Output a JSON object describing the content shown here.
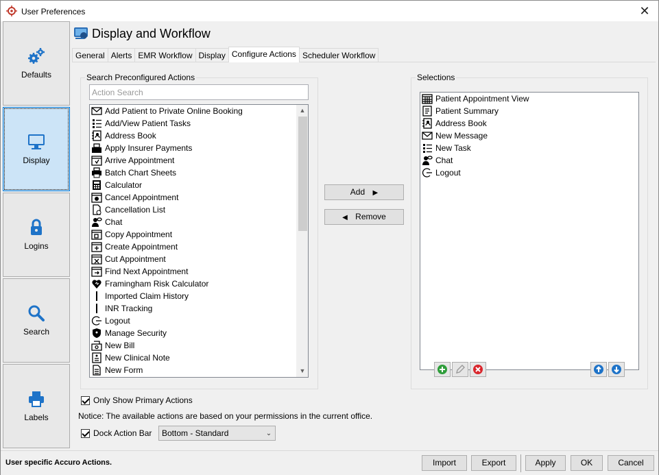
{
  "window": {
    "title": "User Preferences",
    "close_glyph": "✕"
  },
  "sidebar": {
    "items": [
      {
        "label": "Defaults",
        "icon": "gears-icon"
      },
      {
        "label": "Display",
        "icon": "monitor-icon"
      },
      {
        "label": "Logins",
        "icon": "lock-icon"
      },
      {
        "label": "Search",
        "icon": "magnifier-icon"
      },
      {
        "label": "Labels",
        "icon": "printer-icon"
      }
    ]
  },
  "header": {
    "title": "Display and Workflow"
  },
  "tabs": [
    "General",
    "Alerts",
    "EMR Workflow",
    "Display",
    "Configure Actions",
    "Scheduler Workflow"
  ],
  "search_group": {
    "title": "Search Preconfigured Actions",
    "search_placeholder": "Action Search",
    "actions": [
      {
        "label": "Add Patient to Private Online Booking",
        "icon": "envelope-arrow-icon"
      },
      {
        "label": "Add/View Patient Tasks",
        "icon": "task-list-icon"
      },
      {
        "label": "Address Book",
        "icon": "address-book-icon"
      },
      {
        "label": "Apply Insurer Payments",
        "icon": "cash-register-icon"
      },
      {
        "label": "Arrive Appointment",
        "icon": "calendar-arrive-icon"
      },
      {
        "label": "Batch Chart Sheets",
        "icon": "printer-icon"
      },
      {
        "label": "Calculator",
        "icon": "calculator-icon"
      },
      {
        "label": "Cancel Appointment",
        "icon": "calendar-cancel-icon"
      },
      {
        "label": "Cancellation List",
        "icon": "document-icon"
      },
      {
        "label": "Chat",
        "icon": "chat-icon"
      },
      {
        "label": "Copy Appointment",
        "icon": "calendar-copy-icon"
      },
      {
        "label": "Create Appointment",
        "icon": "calendar-create-icon"
      },
      {
        "label": "Cut Appointment",
        "icon": "calendar-cut-icon"
      },
      {
        "label": "Find Next Appointment",
        "icon": "calendar-find-icon"
      },
      {
        "label": "Framingham Risk Calculator",
        "icon": "heart-icon"
      },
      {
        "label": "Imported Claim History",
        "icon": "bar-icon"
      },
      {
        "label": "INR Tracking",
        "icon": "bar-icon"
      },
      {
        "label": "Logout",
        "icon": "logout-icon"
      },
      {
        "label": "Manage Security",
        "icon": "shield-icon"
      },
      {
        "label": "New Bill",
        "icon": "bill-icon"
      },
      {
        "label": "New Clinical Note",
        "icon": "note-icon"
      },
      {
        "label": "New Form",
        "icon": "form-icon"
      }
    ]
  },
  "move_buttons": {
    "add": "Add",
    "remove": "Remove"
  },
  "selections_group": {
    "title": "Selections",
    "items": [
      {
        "label": "Patient Appointment View",
        "icon": "calendar-grid-icon"
      },
      {
        "label": "Patient Summary",
        "icon": "summary-icon"
      },
      {
        "label": "Address Book",
        "icon": "address-book-icon"
      },
      {
        "label": "New Message",
        "icon": "envelope-icon"
      },
      {
        "label": "New Task",
        "icon": "task-list-icon"
      },
      {
        "label": "Chat",
        "icon": "chat-icon"
      },
      {
        "label": "Logout",
        "icon": "logout-icon"
      }
    ]
  },
  "options": {
    "only_primary_label": "Only Show Primary Actions",
    "only_primary_checked": true,
    "notice": "Notice: The available actions are based on your permissions in the current office.",
    "dock_label": "Dock Action Bar",
    "dock_checked": true,
    "dock_value": "Bottom - Standard"
  },
  "status": {
    "text": "User specific Accuro Actions."
  },
  "footer_buttons": {
    "import": "Import",
    "export": "Export",
    "apply": "Apply",
    "ok": "OK",
    "cancel": "Cancel"
  },
  "colors": {
    "accent": "#0078d7",
    "active_bg": "#cce4f7",
    "add_green": "#2e9d3a",
    "delete_red": "#d9262c",
    "arrow_blue": "#1e73c8"
  }
}
